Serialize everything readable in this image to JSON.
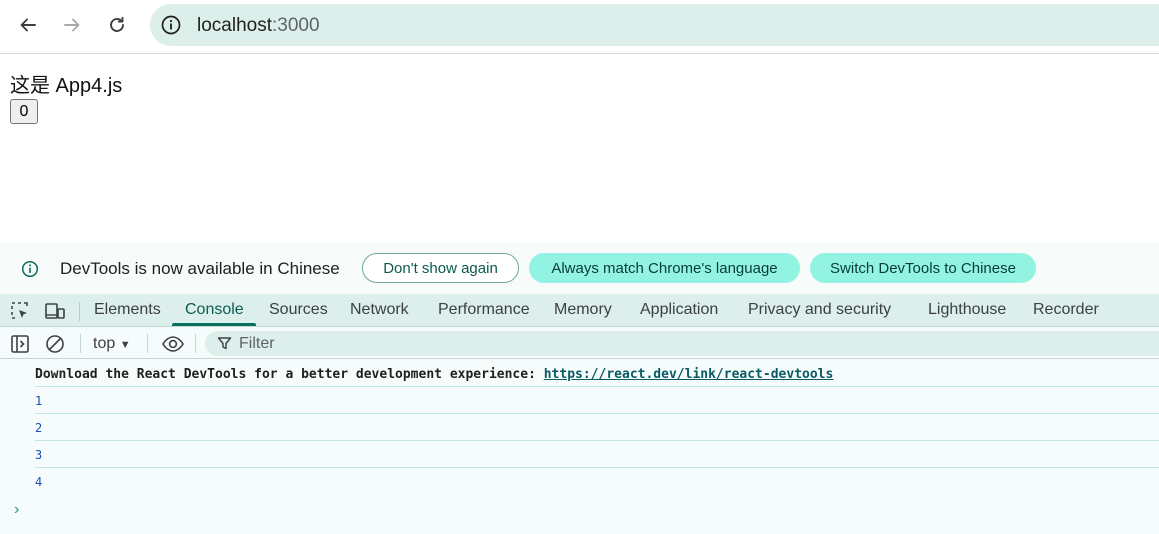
{
  "browser": {
    "url_host": "localhost",
    "url_port": ":3000"
  },
  "page": {
    "heading": "这是 App4.js",
    "counter_value": "0"
  },
  "devtools": {
    "banner": {
      "message": "DevTools is now available in Chinese",
      "dont_show": "Don't show again",
      "always_match": "Always match Chrome's language",
      "switch": "Switch DevTools to Chinese"
    },
    "tabs": [
      "Elements",
      "Console",
      "Sources",
      "Network",
      "Performance",
      "Memory",
      "Application",
      "Privacy and security",
      "Lighthouse",
      "Recorder"
    ],
    "active_tab": "Console",
    "console_toolbar": {
      "context": "top",
      "filter_placeholder": "Filter"
    },
    "messages": {
      "react_text": "Download the React DevTools for a better development experience: ",
      "react_link": "https://react.dev/link/react-devtools",
      "logs": [
        "1",
        "2",
        "3",
        "4"
      ]
    },
    "prompt_symbol": "›"
  }
}
